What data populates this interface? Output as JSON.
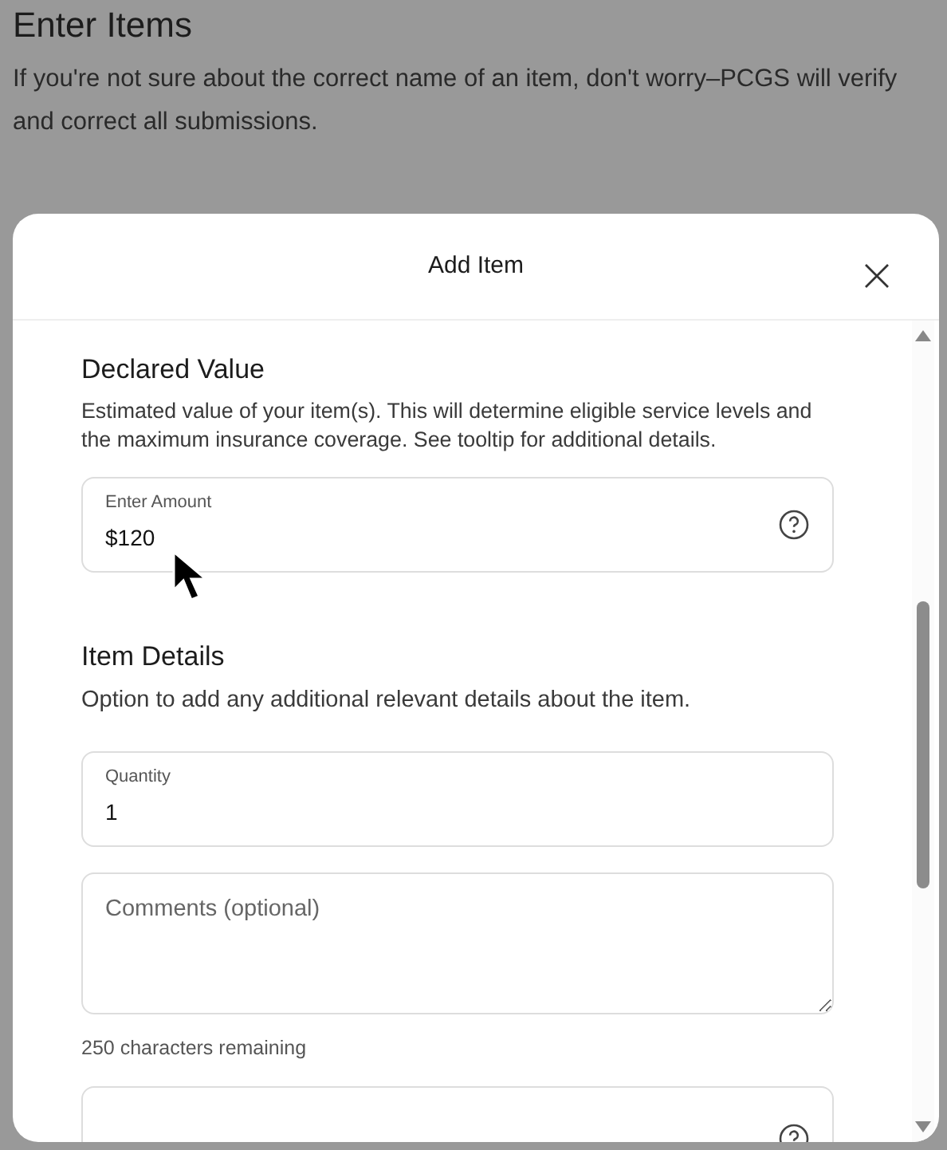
{
  "page": {
    "title": "Enter Items",
    "description": "If you're not sure about the correct name of an item, don't worry–PCGS will verify and correct all submissions."
  },
  "modal": {
    "title": "Add Item",
    "sections": [
      {
        "heading": "Declared Value",
        "description": "Estimated value of your item(s). This will determine eligible service levels and the maximum insurance coverage. See tooltip for additional details.",
        "fields": [
          {
            "kind": "input",
            "label": "Enter Amount",
            "value": "$120",
            "help": true
          }
        ]
      },
      {
        "heading": "Item Details",
        "description": "Option to add any additional relevant details about the item.",
        "fields": [
          {
            "kind": "input",
            "label": "Quantity",
            "value": "1",
            "help": false
          },
          {
            "kind": "textarea",
            "placeholder": "Comments (optional)",
            "note": "250 characters remaining"
          },
          {
            "kind": "cut",
            "help": true
          }
        ]
      }
    ]
  }
}
